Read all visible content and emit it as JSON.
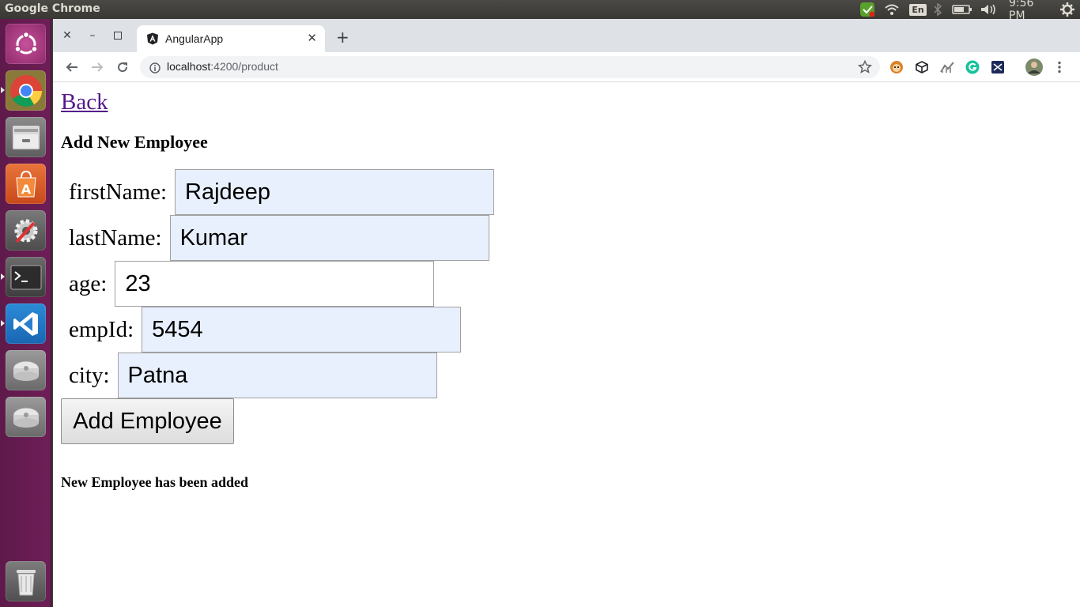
{
  "os": {
    "panel_title": "Google Chrome",
    "clock": "9:56 PM",
    "keyboard_layout": "En"
  },
  "browser": {
    "tab_title": "AngularApp",
    "url_host": "localhost",
    "url_path": ":4200/product"
  },
  "page": {
    "back_link": "Back",
    "heading": "Add New Employee",
    "fields": [
      {
        "label": "firstName:",
        "value": "Rajdeep"
      },
      {
        "label": "lastName:",
        "value": "Kumar"
      },
      {
        "label": "age:",
        "value": "23"
      },
      {
        "label": "empId:",
        "value": "5454"
      },
      {
        "label": "city:",
        "value": "Patna"
      }
    ],
    "submit_label": "Add Employee",
    "status_message": "New Employee has been added"
  },
  "colors": {
    "launcher": "#6e1e57",
    "autofill_bg": "#e8f0fe",
    "visited_link": "#551a8b"
  }
}
